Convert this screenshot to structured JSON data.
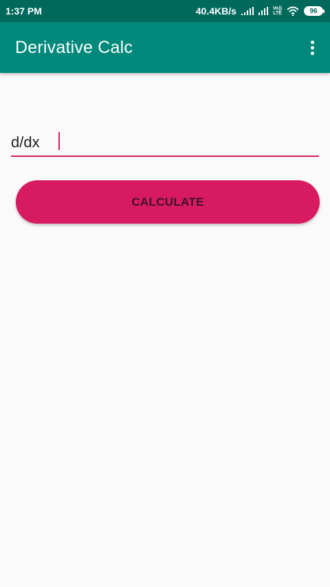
{
  "status_bar": {
    "time": "1:37 PM",
    "network_speed": "40.4KB/s",
    "volte_label_top": "Vo))",
    "volte_label_bottom": "LTE",
    "battery_level": "96",
    "icons": [
      "signal-icon",
      "signal-icon",
      "volte-icon",
      "wifi-icon",
      "battery-icon"
    ]
  },
  "app_bar": {
    "title": "Derivative Calc",
    "menu_icon": "overflow-menu-icon"
  },
  "expression_input": {
    "value": "d/dx",
    "placeholder": ""
  },
  "calculate_button": {
    "label": "CALCULATE"
  },
  "colors": {
    "status_bar": "#00695c",
    "app_bar": "#00897b",
    "accent": "#d81b60",
    "background": "#fafafa"
  }
}
